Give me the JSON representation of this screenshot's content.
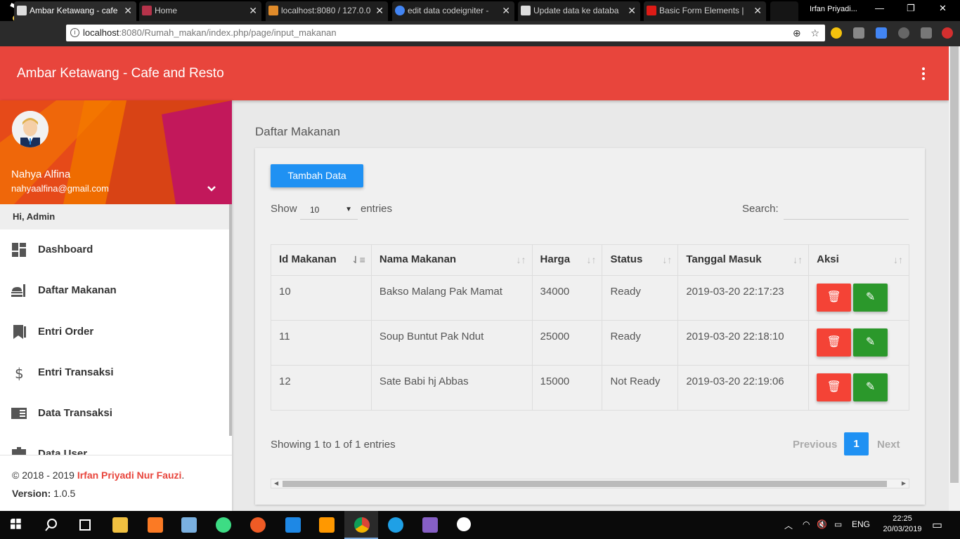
{
  "browser": {
    "tabs": [
      {
        "title": "Ambar Ketawang - cafe",
        "active": true
      },
      {
        "title": "Home",
        "active": false
      },
      {
        "title": "localhost:8080 / 127.0.0",
        "active": false
      },
      {
        "title": "edit data codeigniter -",
        "active": false
      },
      {
        "title": "Update data ke databa",
        "active": false
      },
      {
        "title": "Basic Form Elements |",
        "active": false
      }
    ],
    "profile_name": "Irfan Priyadi...",
    "url_host": "localhost",
    "url_path": ":8080/Rumah_makan/index.php/page/input_makanan"
  },
  "app": {
    "title": "Ambar Ketawang - Cafe and Resto",
    "accent_color": "#e8453c",
    "user": {
      "name": "Nahya Alfina",
      "email": "nahyaalfina@gmail.com"
    },
    "menu_header": "Hi, Admin",
    "menu": [
      {
        "label": "Dashboard",
        "icon": "dashboard-icon"
      },
      {
        "label": "Daftar Makanan",
        "icon": "food-icon"
      },
      {
        "label": "Entri Order",
        "icon": "bookmark-icon"
      },
      {
        "label": "Entri Transaksi",
        "icon": "dollar-icon"
      },
      {
        "label": "Data Transaksi",
        "icon": "chrome-reader-icon"
      },
      {
        "label": "Data User",
        "icon": "badge-icon"
      }
    ],
    "footer": {
      "copyright_prefix": "© 2018 - 2019 ",
      "author": "Irfan Priyadi Nur Fauzi",
      "suffix": ".",
      "version_label": "Version:",
      "version": " 1.0.5"
    }
  },
  "main": {
    "heading": "Daftar Makanan",
    "add_button": "Tambah Data",
    "length": {
      "show": "Show",
      "value": "10",
      "entries": "entries"
    },
    "search_label": "Search:",
    "search_value": "",
    "table": {
      "columns": [
        "Id Makanan",
        "Nama Makanan",
        "Harga",
        "Status",
        "Tanggal Masuk",
        "Aksi"
      ],
      "rows": [
        [
          "10",
          "Bakso Malang Pak Mamat",
          "34000",
          "Ready",
          "2019-03-20 22:17:23"
        ],
        [
          "11",
          "Soup Buntut Pak Ndut",
          "25000",
          "Ready",
          "2019-03-20 22:18:10"
        ],
        [
          "12",
          "Sate Babi hj Abbas",
          "15000",
          "Not Ready",
          "2019-03-20 22:19:06"
        ]
      ]
    },
    "info": "Showing 1 to 1 of 1 entries",
    "pagination": {
      "previous": "Previous",
      "current": "1",
      "next": "Next"
    }
  },
  "taskbar": {
    "lang": "ENG",
    "time": "22:25",
    "date": "20/03/2019"
  }
}
